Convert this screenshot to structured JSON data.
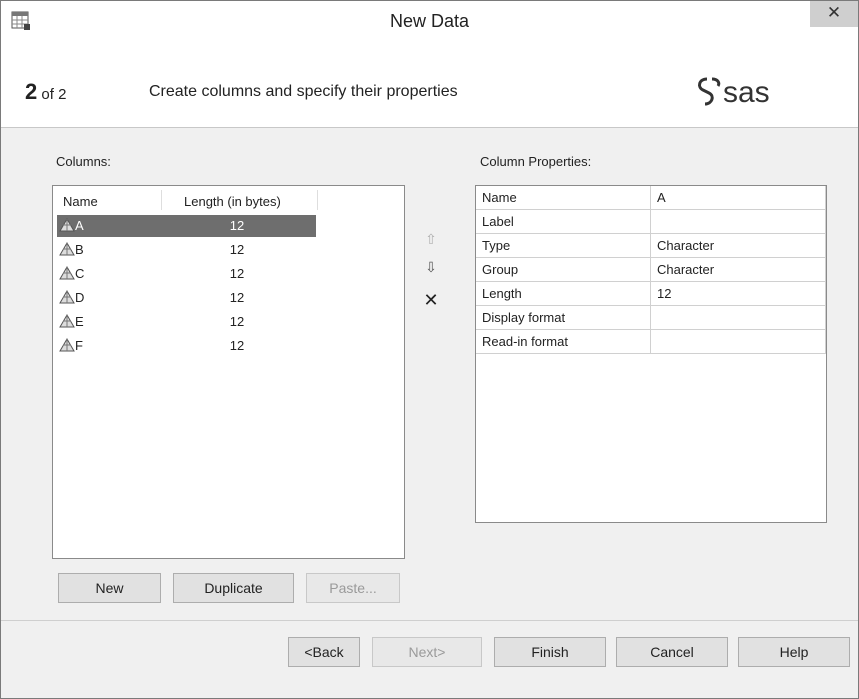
{
  "window": {
    "title": "New Data",
    "close_glyph": "✕"
  },
  "header": {
    "step_number": "2",
    "step_of": "of 2",
    "description": "Create columns and specify their properties",
    "logo": "sas"
  },
  "columns_panel": {
    "label": "Columns:",
    "headers": {
      "name": "Name",
      "length": "Length (in bytes)"
    },
    "rows": [
      {
        "name": "A",
        "length": "12",
        "selected": true
      },
      {
        "name": "B",
        "length": "12"
      },
      {
        "name": "C",
        "length": "12"
      },
      {
        "name": "D",
        "length": "12"
      },
      {
        "name": "E",
        "length": "12"
      },
      {
        "name": "F",
        "length": "12"
      }
    ]
  },
  "mover": {
    "up": "⇧",
    "down": "⇩",
    "delete": "✕"
  },
  "properties_panel": {
    "label": "Column Properties:",
    "rows": [
      {
        "key": "Name",
        "value": "A"
      },
      {
        "key": "Label",
        "value": ""
      },
      {
        "key": "Type",
        "value": "Character"
      },
      {
        "key": "Group",
        "value": "Character"
      },
      {
        "key": "Length",
        "value": "12"
      },
      {
        "key": "Display format",
        "value": ""
      },
      {
        "key": "Read-in format",
        "value": ""
      }
    ]
  },
  "list_buttons": {
    "new": "New",
    "duplicate": "Duplicate",
    "paste": "Paste..."
  },
  "footer_buttons": {
    "back": "<Back",
    "next": "Next>",
    "finish": "Finish",
    "cancel": "Cancel",
    "help": "Help"
  }
}
